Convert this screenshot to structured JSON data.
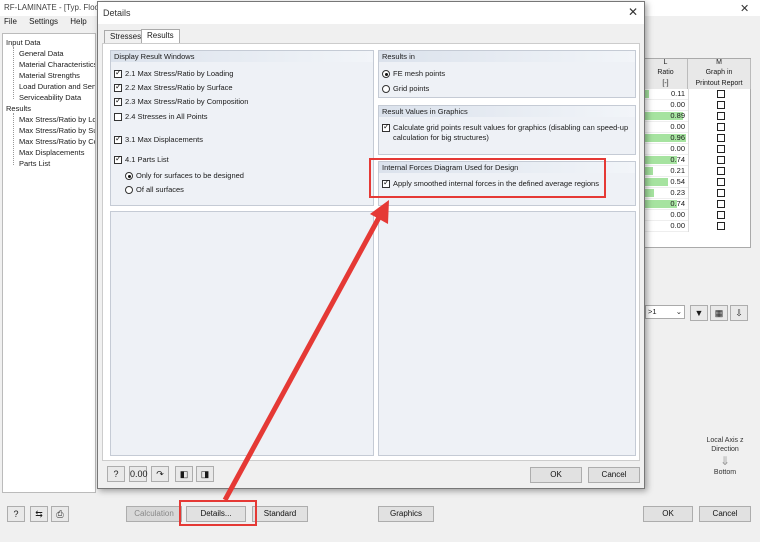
{
  "main": {
    "title": "RF-LAMINATE - [Typ. Floo",
    "menus": [
      "File",
      "Settings",
      "Help"
    ],
    "tree": [
      {
        "label": "Input Data",
        "level": 0
      },
      {
        "label": "General Data",
        "level": 1
      },
      {
        "label": "Material Characteristics",
        "level": 1
      },
      {
        "label": "Material Strengths",
        "level": 1
      },
      {
        "label": "Load Duration and Serv",
        "level": 1
      },
      {
        "label": "Serviceability Data",
        "level": 1
      },
      {
        "label": "Results",
        "level": 0
      },
      {
        "label": "Max Stress/Ratio by Lo",
        "level": 1
      },
      {
        "label": "Max Stress/Ratio by Su",
        "level": 1
      },
      {
        "label": "Max Stress/Ratio by Co",
        "level": 1
      },
      {
        "label": "Max Displacements",
        "level": 1
      },
      {
        "label": "Parts List",
        "level": 1
      }
    ],
    "table": {
      "col_l_letter": "L",
      "col_m_letter": "M",
      "col_l_title": "Ratio",
      "col_l_unit": "[-]",
      "col_m_title_1": "Graph in",
      "col_m_title_2": "Printout Report",
      "ratios": [
        "0.11",
        "0.00",
        "0.89",
        "0.00",
        "0.96",
        "0.00",
        "0.74",
        "0.21",
        "0.54",
        "0.23",
        "0.74",
        "0.00",
        "0.00"
      ],
      "bar_fraction": [
        0.11,
        0.0,
        0.89,
        0.0,
        0.96,
        0.0,
        0.74,
        0.21,
        0.54,
        0.23,
        0.74,
        0.0,
        0.0
      ]
    },
    "filter_select_value": ">1",
    "axis_label_1": "Local Axis z",
    "axis_label_2": "Direction",
    "axis_label_3": "Bottom",
    "buttons": {
      "calculation": "Calculation",
      "details": "Details...",
      "standard": "Standard",
      "graphics": "Graphics",
      "ok": "OK",
      "cancel": "Cancel"
    }
  },
  "dialog": {
    "title": "Details",
    "tabs": [
      "Stresses",
      "Results"
    ],
    "display_windows": {
      "header": "Display Result Windows",
      "items": [
        {
          "label": "2.1 Max Stress/Ratio by Loading",
          "checked": true
        },
        {
          "label": "2.2 Max Stress/Ratio by Surface",
          "checked": true
        },
        {
          "label": "2.3 Max Stress/Ratio by Composition",
          "checked": true
        },
        {
          "label": "2.4 Stresses in All Points",
          "checked": false
        },
        {
          "label": "3.1 Max Displacements",
          "checked": true
        },
        {
          "label": "4.1 Parts List",
          "checked": true
        }
      ],
      "parts_options": [
        {
          "label": "Only for surfaces to be designed",
          "selected": true
        },
        {
          "label": "Of all surfaces",
          "selected": false
        }
      ]
    },
    "results_in": {
      "header": "Results in",
      "options": [
        {
          "label": "FE mesh points",
          "selected": true
        },
        {
          "label": "Grid points",
          "selected": false
        }
      ]
    },
    "result_values": {
      "header": "Result Values in Graphics",
      "line1": "Calculate grid points result values for graphics (disabling can speed-up",
      "line2": "calculation for big structures)",
      "checked": true
    },
    "internal_forces": {
      "header": "Internal Forces Diagram Used for Design",
      "label": "Apply smoothed internal forces in the defined average regions",
      "checked": true
    },
    "ok": "OK",
    "cancel": "Cancel"
  },
  "colors": {
    "highlight": "#e53935",
    "ratio_bar": "#a6e3a0"
  }
}
